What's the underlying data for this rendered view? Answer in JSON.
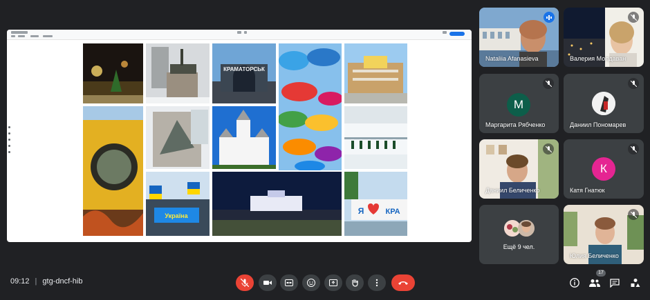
{
  "meeting": {
    "time": "09:12",
    "separator": "|",
    "code": "gtg-dncf-hib"
  },
  "participants": [
    {
      "name": "Nataliia Afanasieva",
      "state": "speaking"
    },
    {
      "name": "Валерия Молдаван",
      "state": "muted"
    },
    {
      "name": "Маргарита Рябченко",
      "initial": "М",
      "avatar_color": "#0d5e4a",
      "state": "muted"
    },
    {
      "name": "Даниил Пономарев",
      "state": "muted"
    },
    {
      "name": "Даниил Беличенко",
      "state": "muted"
    },
    {
      "name": "Катя Гнатюк",
      "initial": "К",
      "avatar_color": "#e52592",
      "state": "muted"
    },
    {
      "name": "Ещё 9 чел."
    },
    {
      "name": "Юлия Беличенко",
      "state": "muted"
    }
  ],
  "slide": {
    "photo_texts": {
      "kramatorsk_sign": "КРАМАТОРСЬК",
      "rally_banner": "Україна",
      "love_banner_i": "Я",
      "love_banner_word": "КРА"
    }
  },
  "people_count": "17",
  "colors": {
    "background": "#202124",
    "tile": "#3c4043",
    "accent": "#8ab4f8",
    "end_call": "#ea4335"
  }
}
